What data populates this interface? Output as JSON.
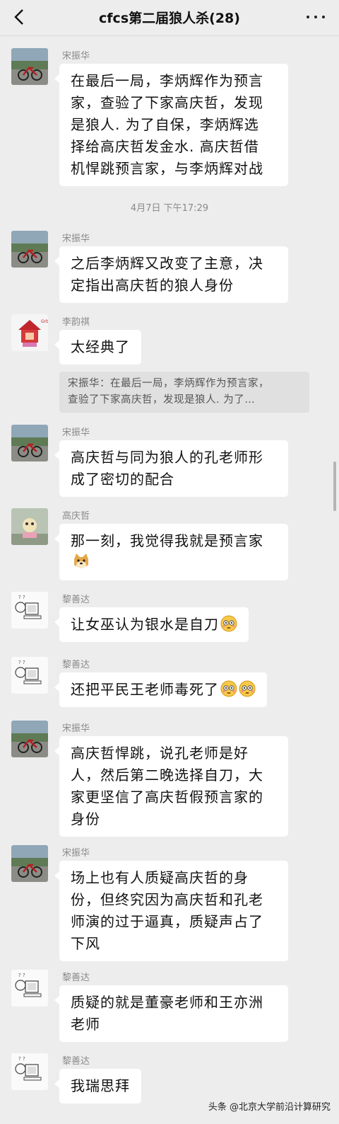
{
  "header": {
    "title": "cfcs第二届狼人杀(28)"
  },
  "messages": [
    {
      "sender": "宋振华",
      "lines": [
        "在最后一局，李炳辉作为预言",
        "家，查验了下家高庆哲，发现",
        "是狼人. 为了自保，李炳辉选",
        "择给高庆哲发金水. 高庆哲借",
        "机悍跳预言家，与李炳辉对战"
      ]
    },
    {
      "sender": "宋振华",
      "lines": [
        "之后李炳辉又改变了主意，决",
        "定指出高庆哲的狼人身份"
      ]
    },
    {
      "sender": "李韵祺",
      "lines": [
        "太经典了"
      ]
    },
    {
      "sender": "宋振华",
      "lines": [
        "高庆哲与同为狼人的孔老师形",
        "成了密切的配合"
      ]
    },
    {
      "sender": "高庆哲",
      "lines": [
        "那一刻，我觉得我就是预言家"
      ]
    },
    {
      "sender": "黎善达",
      "lines": [
        "让女巫认为银水是自刀"
      ]
    },
    {
      "sender": "黎善达",
      "lines": [
        "还把平民王老师毒死了"
      ]
    },
    {
      "sender": "宋振华",
      "lines": [
        "高庆哲悍跳，说孔老师是好",
        "人，然后第二晚选择自刀，大",
        "家更坚信了高庆哲假预言家的",
        "身份"
      ]
    },
    {
      "sender": "宋振华",
      "lines": [
        "场上也有人质疑高庆哲的身",
        "份，但终究因为高庆哲和孔老",
        "师演的过于逼真，质疑声占了",
        "下风"
      ]
    },
    {
      "sender": "黎善达",
      "lines": [
        "质疑的就是董豪老师和王亦洲",
        "老师"
      ]
    },
    {
      "sender": "黎善达",
      "lines": [
        "我瑞思拜"
      ]
    }
  ],
  "timestamp": "4月7日  下午17:29",
  "quote": {
    "lines": [
      "宋振华：在最后一局，李炳辉作为预言家，",
      "查验了下家高庆哲，发现是狼人. 为了…"
    ]
  },
  "emojis": [
    "doge-emoji",
    "flushed-face-emoji"
  ],
  "watermark": "头条 @北京大学前沿计算研究",
  "colors": {
    "background": "#ededed",
    "bubble": "#ffffff",
    "quote_bg": "#e0e0e0",
    "meta_text": "#8a8a8a"
  }
}
